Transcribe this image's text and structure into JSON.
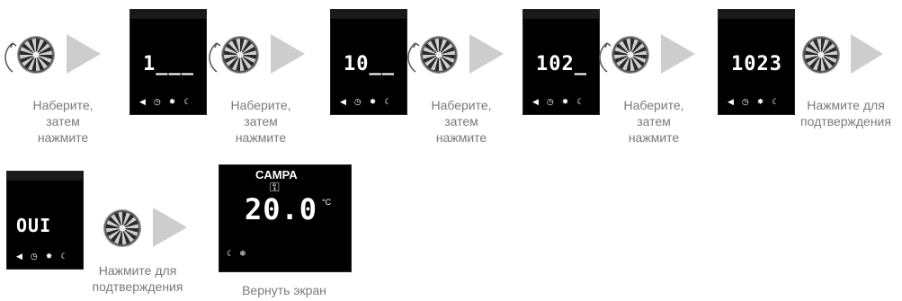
{
  "steps": [
    {
      "display": "1___",
      "caption": [
        "Наберите,",
        "затем",
        "нажмите"
      ]
    },
    {
      "display": "10__",
      "caption": [
        "Наберите,",
        "затем",
        "нажмите"
      ]
    },
    {
      "display": "102_",
      "caption": [
        "Наберите,",
        "затем",
        "нажмите"
      ]
    },
    {
      "display": "1023",
      "caption": [
        "Наберите,",
        "затем",
        "нажмите"
      ]
    },
    {
      "display": "",
      "caption": [
        "Нажмите для",
        "подтверждения"
      ]
    }
  ],
  "step_row2": {
    "display": "OUI",
    "caption": [
      "Нажмите для",
      "подтверждения"
    ]
  },
  "home_screen": {
    "brand": "CAMPA",
    "temperature": "20.0",
    "unit": "°C",
    "caption": "Вернуть экран"
  },
  "icons": {
    "sound": "speaker-icon",
    "clock": "clock-icon",
    "sun": "sun-icon",
    "moon": "moon-icon",
    "snow": "snowflake-icon",
    "key": "key-icon"
  },
  "colors": {
    "panel_bg": "#000000",
    "arrow": "#cdcdcd",
    "caption": "#7a7a7a"
  }
}
